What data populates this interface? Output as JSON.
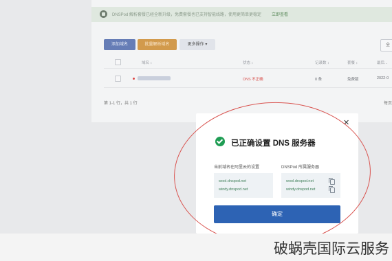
{
  "notice": {
    "icon": "speaker-icon",
    "text": "DNSPod 解析套餐已经全新升级，免费套餐也已支持智能线路，使用更简单更稳定",
    "link": "立即查看"
  },
  "toolbar": {
    "add_label": "添加域名",
    "batch_label": "批量解析域名",
    "more_label": "更多操作 ▾",
    "right_label": "全"
  },
  "table": {
    "headers": [
      "域名 ↕",
      "状态 ↕",
      "记录数 ↕",
      "套餐 ↕",
      "最后..."
    ],
    "row": {
      "domain": "",
      "status": "DNS 不正确",
      "records": "0 条",
      "plan": "免费版",
      "date": "2022-0"
    },
    "footer_left": "第 1-1 行，共 1 行",
    "footer_right": "每页"
  },
  "modal": {
    "title": "已正确设置 DNS 服务器",
    "close_icon": "close-icon",
    "left_label": "当前域名在阿里云的设置",
    "right_label": "DNSPod 所属服务器",
    "left_ns": [
      "wool.dnspod.net",
      "windy.dnspod.net"
    ],
    "right_ns": [
      "wool.dnspod.net",
      "windy.dnspod.net"
    ],
    "confirm": "确定"
  },
  "watermark": "破蜗壳国际云服务",
  "colors": {
    "primary": "#2d63b4",
    "success": "#1f9d54",
    "warning": "#d29a4c",
    "error": "#d9534f"
  }
}
